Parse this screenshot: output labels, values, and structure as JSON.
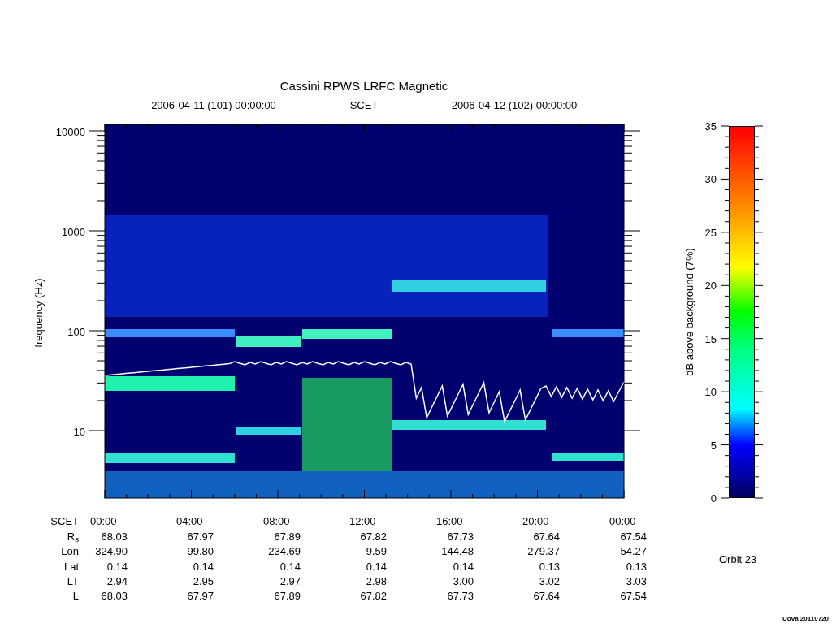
{
  "title": "Cassini RPWS LRFC Magnetic",
  "subtitle": {
    "start": "2006-04-11 (101) 00:00:00",
    "scet": "SCET",
    "end": "2006-04-12 (102) 00:00:00"
  },
  "y_axis": {
    "label": "frequency (Hz)",
    "ticks": [
      "10000",
      "1000",
      "100",
      "10"
    ]
  },
  "colorbar": {
    "label": "dB above background (7%)",
    "ticks": [
      "35",
      "30",
      "25",
      "20",
      "15",
      "10",
      "5",
      "0"
    ]
  },
  "ephemeris": [
    {
      "label": "SCET",
      "values": [
        "00:00",
        "04:00",
        "08:00",
        "12:00",
        "16:00",
        "20:00",
        "00:00"
      ]
    },
    {
      "label": "R$_{s}$",
      "values": [
        "68.03",
        "67.97",
        "67.89",
        "67.82",
        "67.73",
        "67.64",
        "67.54"
      ]
    },
    {
      "label": "Lon",
      "values": [
        "324.90",
        "99.80",
        "234.69",
        "9.59",
        "144.48",
        "279.37",
        "54.27"
      ]
    },
    {
      "label": "Lat",
      "values": [
        "0.14",
        "0.14",
        "0.14",
        "0.14",
        "0.14",
        "0.13",
        "0.13"
      ]
    },
    {
      "label": "LT",
      "values": [
        "2.94",
        "2.95",
        "2.97",
        "2.98",
        "3.00",
        "3.02",
        "3.03"
      ]
    },
    {
      "label": "L",
      "values": [
        "68.03",
        "67.97",
        "67.89",
        "67.82",
        "67.73",
        "67.64",
        "67.54"
      ]
    }
  ],
  "orbit": "Orbit 23",
  "stamp": "Uova 20110720"
}
